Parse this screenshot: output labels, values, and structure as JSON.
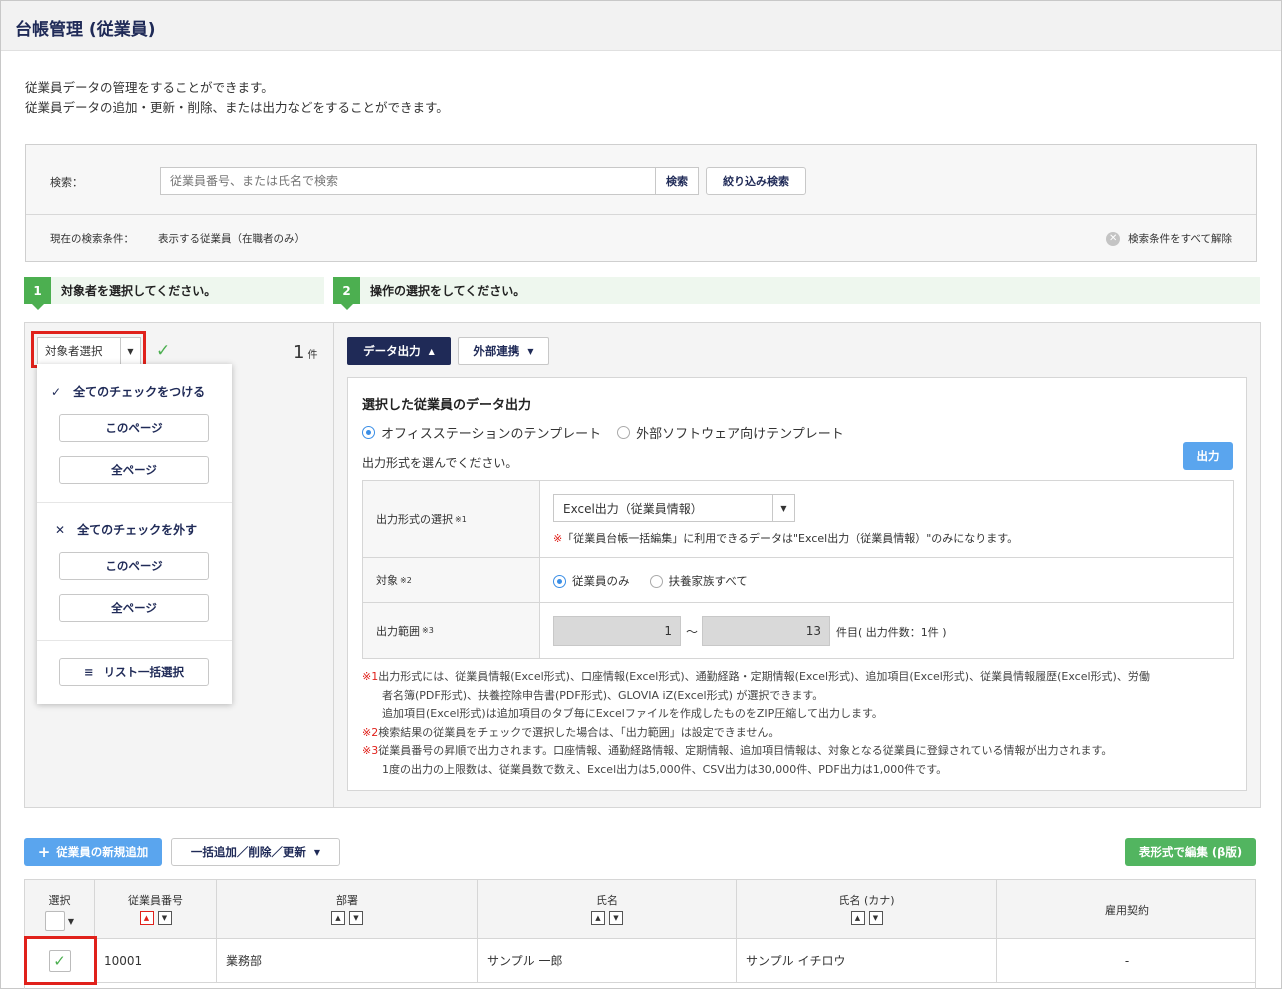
{
  "page": {
    "title": "台帳管理 (従業員)"
  },
  "description": {
    "line1": "従業員データの管理をすることができます。",
    "line2": "従業員データの追加・更新・削除、または出力などをすることができます。"
  },
  "search": {
    "label": "検索：",
    "placeholder": "従業員番号、または氏名で検索",
    "search_button": "検索",
    "filter_button": "絞り込み検索",
    "condition_label": "現在の検索条件：",
    "condition_value": "表示する従業員（在職者のみ）",
    "clear_all": "検索条件をすべて解除"
  },
  "steps": [
    {
      "num": "1",
      "text": "対象者を選択してください。"
    },
    {
      "num": "2",
      "text": "操作の選択をしてください。"
    }
  ],
  "target_select": {
    "label": "対象者選択",
    "count": "1",
    "count_unit": "件",
    "menu": {
      "check_all": "全てのチェックをつける",
      "uncheck_all": "全てのチェックを外す",
      "this_page": "このページ",
      "all_pages": "全ページ",
      "list_select": "リスト一括選択"
    }
  },
  "tabs": {
    "data_output": "データ出力",
    "external": "外部連携"
  },
  "output": {
    "heading": "選択した従業員のデータ出力",
    "template_office": "オフィスステーションのテンプレート",
    "template_external": "外部ソフトウェア向けテンプレート",
    "hint": "出力形式を選んでください。",
    "output_button": "出力",
    "format_label": "出力形式の選択",
    "format_sup": "※1",
    "format_value": "Excel出力（従業員情報）",
    "format_note_mark": "※",
    "format_note": "「従業員台帳一括編集」に利用できるデータは\"Excel出力（従業員情報）\"のみになります。",
    "target_label": "対象",
    "target_sup": "※2",
    "target_only": "従業員のみ",
    "target_family": "扶養家族すべて",
    "range_label": "出力範囲",
    "range_sup": "※3",
    "range_from": "1",
    "range_sep": "〜",
    "range_to": "13",
    "range_suffix": "件目( 出力件数：1件 )",
    "notes": [
      {
        "mark": "※1",
        "text": "出力形式には、従業員情報(Excel形式)、口座情報(Excel形式)、通勤経路・定期情報(Excel形式)、追加項目(Excel形式)、従業員情報履歴(Excel形式)、労働"
      },
      {
        "mark": "",
        "text": "者名簿(PDF形式)、扶養控除申告書(PDF形式)、GLOVIA iZ(Excel形式) が選択できます。"
      },
      {
        "mark": "",
        "text": "追加項目(Excel形式)は追加項目のタブ毎にExcelファイルを作成したものをZIP圧縮して出力します。"
      },
      {
        "mark": "※2",
        "text": "検索結果の従業員をチェックで選択した場合は、「出力範囲」は設定できません。"
      },
      {
        "mark": "※3",
        "text": "従業員番号の昇順で出力されます。口座情報、通勤経路情報、定期情報、追加項目情報は、対象となる従業員に登録されている情報が出力されます。"
      },
      {
        "mark": "",
        "text": "1度の出力の上限数は、従業員数で数え、Excel出力は5,000件、CSV出力は30,000件、PDF出力は1,000件です。"
      }
    ]
  },
  "actions": {
    "add_employee": "従業員の新規追加",
    "bulk": "一括追加／削除／更新",
    "grid_edit": "表形式で編集 (β版)"
  },
  "table": {
    "headers": {
      "select": "選択",
      "emp_no": "従業員番号",
      "dept": "部署",
      "name": "氏名",
      "kana": "氏名 (カナ)",
      "contract": "雇用契約"
    },
    "rows": [
      {
        "emp_no": "10001",
        "dept": "業務部",
        "name": "サンプル 一郎",
        "kana": "サンプル イチロウ",
        "contract": "-"
      }
    ]
  }
}
